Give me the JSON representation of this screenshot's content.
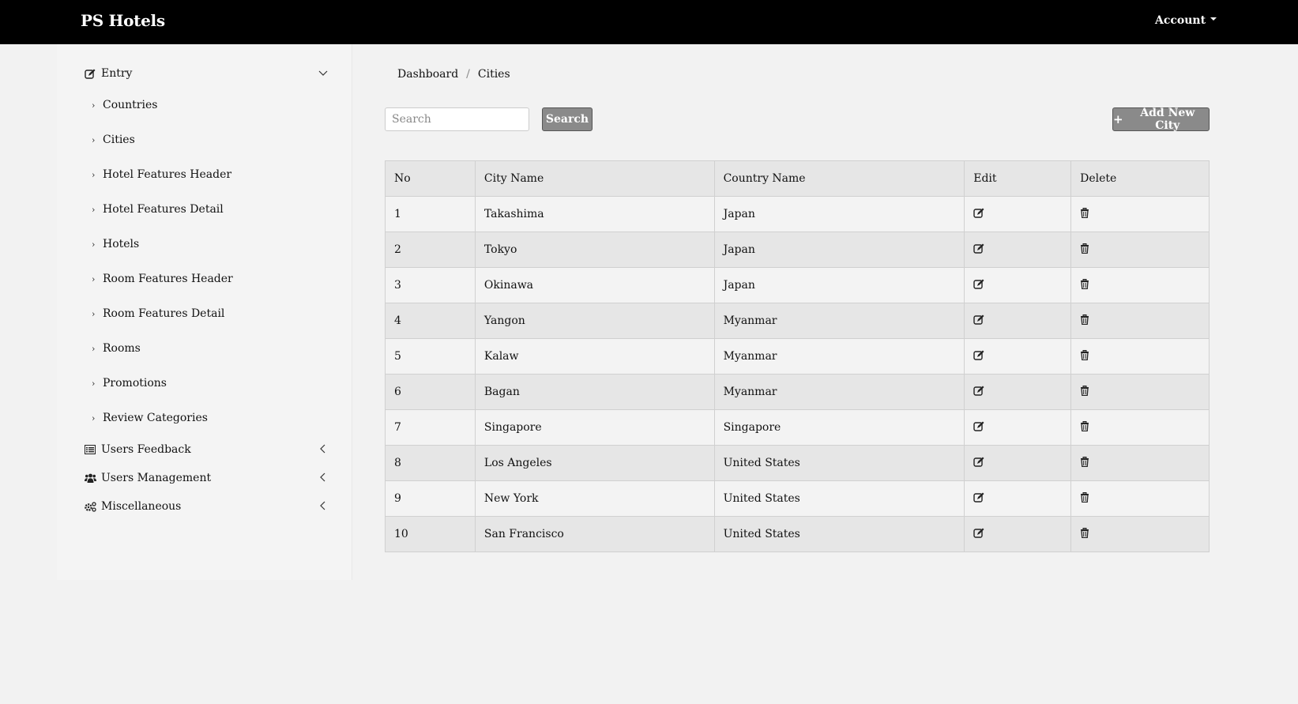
{
  "navbar": {
    "brand": "PS Hotels",
    "account_label": "Account"
  },
  "sidebar": {
    "entry": {
      "label": "Entry",
      "icon": "edit-icon",
      "expanded": true
    },
    "entry_items": [
      {
        "label": "Countries"
      },
      {
        "label": "Cities"
      },
      {
        "label": "Hotel Features Header"
      },
      {
        "label": "Hotel Features Detail"
      },
      {
        "label": "Hotels"
      },
      {
        "label": "Room Features Header"
      },
      {
        "label": "Room Features Detail"
      },
      {
        "label": "Rooms"
      },
      {
        "label": "Promotions"
      },
      {
        "label": "Review Categories"
      }
    ],
    "groups": [
      {
        "label": "Users Feedback",
        "icon": "list-alt-icon"
      },
      {
        "label": "Users Management",
        "icon": "users-icon"
      },
      {
        "label": "Miscellaneous",
        "icon": "cogs-icon"
      }
    ]
  },
  "breadcrumb": {
    "items": [
      "Dashboard",
      "Cities"
    ],
    "separator": "/"
  },
  "toolbar": {
    "search_placeholder": "Search",
    "search_value": "",
    "search_button": "Search",
    "add_button": "Add New City"
  },
  "table": {
    "headers": [
      "No",
      "City Name",
      "Country Name",
      "Edit",
      "Delete"
    ],
    "rows": [
      {
        "no": "1",
        "city": "Takashima",
        "country": "Japan"
      },
      {
        "no": "2",
        "city": "Tokyo",
        "country": "Japan"
      },
      {
        "no": "3",
        "city": "Okinawa",
        "country": "Japan"
      },
      {
        "no": "4",
        "city": "Yangon",
        "country": "Myanmar"
      },
      {
        "no": "5",
        "city": "Kalaw",
        "country": "Myanmar"
      },
      {
        "no": "6",
        "city": "Bagan",
        "country": "Myanmar"
      },
      {
        "no": "7",
        "city": "Singapore",
        "country": "Singapore"
      },
      {
        "no": "8",
        "city": "Los Angeles",
        "country": "United States"
      },
      {
        "no": "9",
        "city": "New York",
        "country": "United States"
      },
      {
        "no": "10",
        "city": "San Francisco",
        "country": "United States"
      }
    ]
  },
  "colors": {
    "navbar_bg": "#000000",
    "page_bg": "#f2f2f2",
    "button_bg": "#8a8a8a",
    "row_alt_bg": "#e6e6e6"
  }
}
